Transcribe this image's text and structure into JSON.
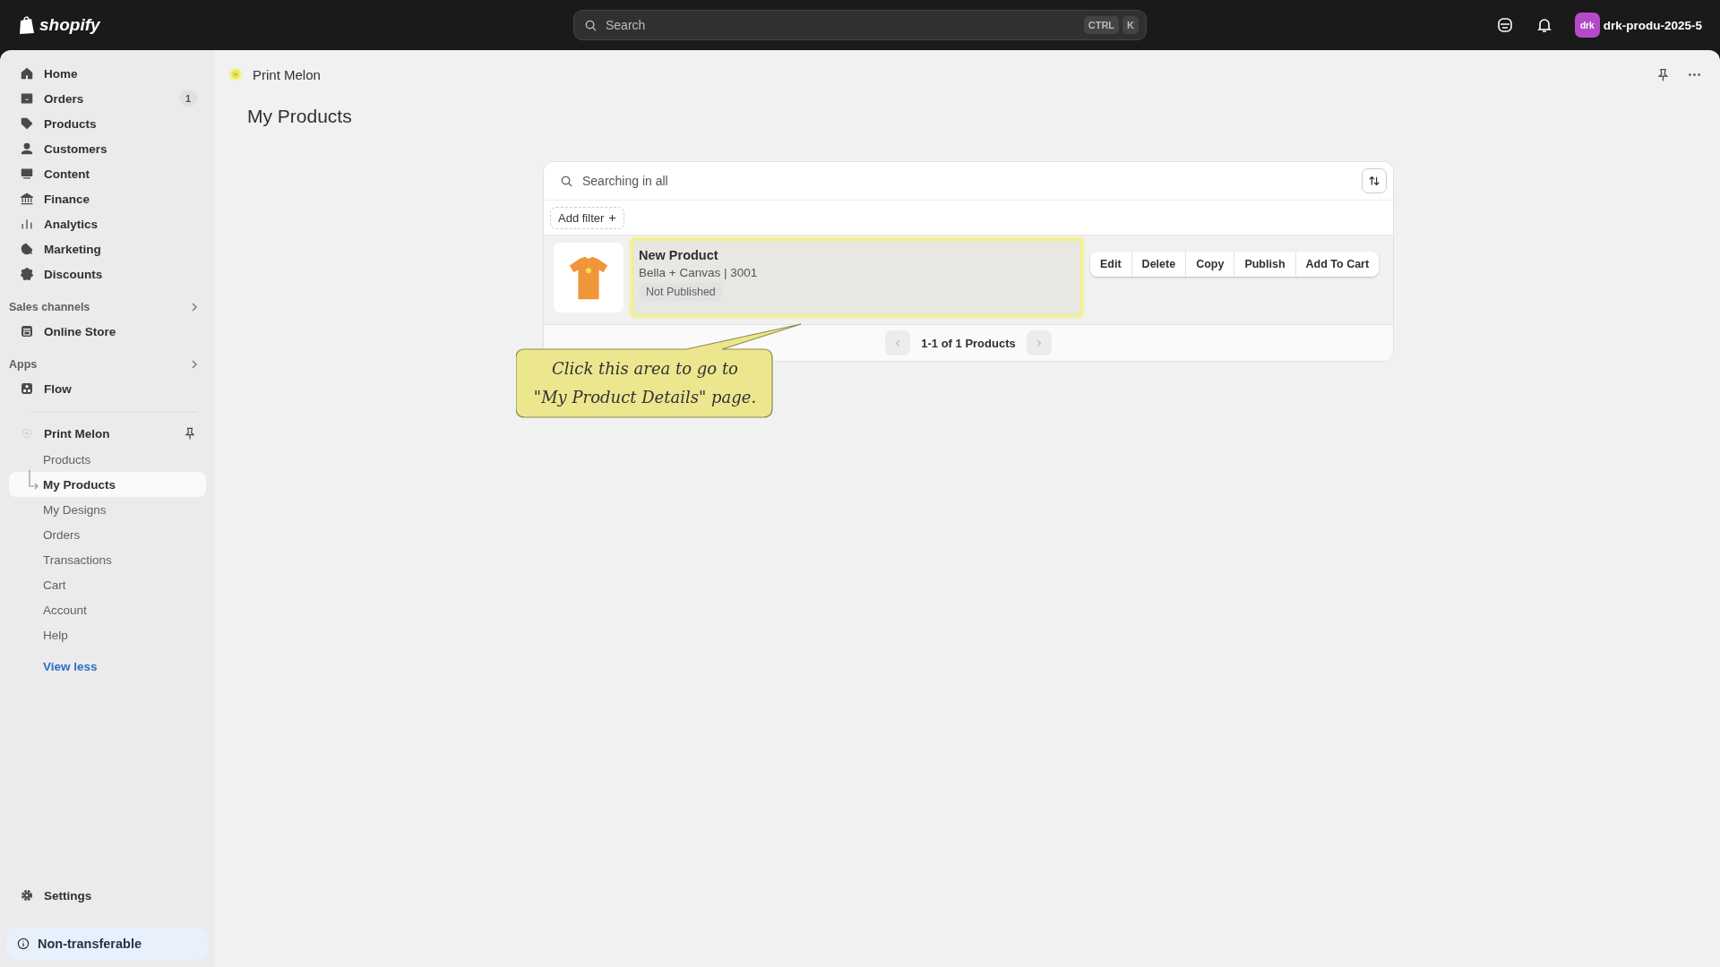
{
  "topbar": {
    "logo_text": "shopify",
    "search": {
      "placeholder": "Search",
      "keys": [
        "CTRL",
        "K"
      ]
    },
    "store": {
      "avatar": "drk",
      "name": "drk-produ-2025-5"
    }
  },
  "sidebar": {
    "items": [
      {
        "label": "Home",
        "selected": false
      },
      {
        "label": "Orders",
        "badge": "1",
        "selected": false
      },
      {
        "label": "Products",
        "selected": false
      },
      {
        "label": "Customers",
        "selected": false
      },
      {
        "label": "Content",
        "selected": false
      },
      {
        "label": "Finance",
        "selected": false
      },
      {
        "label": "Analytics",
        "selected": false
      },
      {
        "label": "Marketing",
        "selected": false
      },
      {
        "label": "Discounts",
        "selected": false
      }
    ],
    "sections": [
      {
        "title": "Sales channels",
        "items": [
          {
            "label": "Online Store",
            "selected": false
          }
        ]
      },
      {
        "title": "Apps",
        "items": [
          {
            "label": "Flow",
            "selected": false
          }
        ]
      }
    ],
    "app": {
      "name": "Print Melon",
      "children": [
        {
          "label": "Products",
          "selected": false
        },
        {
          "label": "My Products",
          "selected": true
        },
        {
          "label": "My Designs",
          "selected": false
        },
        {
          "label": "Orders",
          "selected": false
        },
        {
          "label": "Transactions",
          "selected": false
        },
        {
          "label": "Cart",
          "selected": false
        },
        {
          "label": "Account",
          "selected": false
        },
        {
          "label": "Help",
          "selected": false
        }
      ]
    },
    "view_less": "View less",
    "settings": "Settings",
    "notice": "Non-transferable"
  },
  "page": {
    "breadcrumb": "Print Melon",
    "title": "My Products",
    "search_placeholder": "Searching in all",
    "add_filter": "Add filter",
    "products": [
      {
        "name": "New Product",
        "subtitle": "Bella + Canvas | 3001",
        "status": "Not Published",
        "highlighted": true,
        "actions": [
          "Edit",
          "Delete",
          "Copy",
          "Publish",
          "Add To Cart"
        ]
      }
    ],
    "pagination": {
      "label": "1-1 of 1 Products",
      "prev_disabled": true,
      "next_disabled": true
    },
    "callout": [
      "Click this area to go to",
      "\"My Product Details\" page."
    ]
  }
}
